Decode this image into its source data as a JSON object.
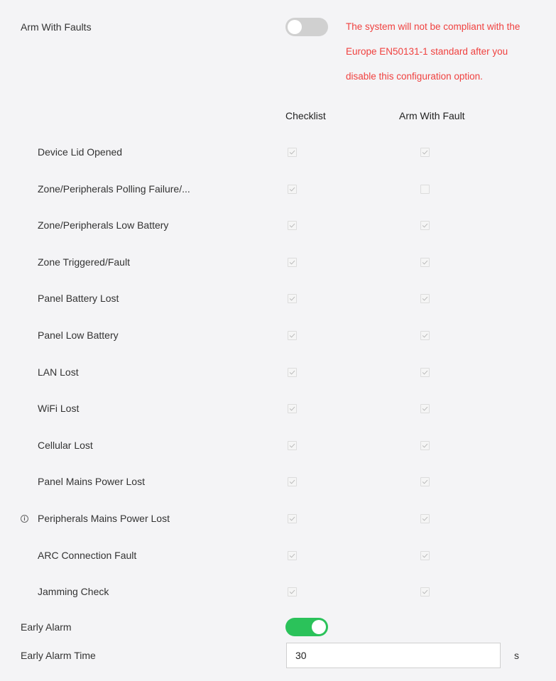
{
  "arm_with_faults": {
    "label": "Arm With Faults",
    "enabled": false,
    "warning_lines": [
      "The system will not be compliant with the",
      "Europe EN50131-1 standard after you",
      "disable this configuration option."
    ]
  },
  "columns": {
    "checklist": "Checklist",
    "arm_with_fault": "Arm With Fault"
  },
  "rows": [
    {
      "label": "Device Lid Opened",
      "checklist": true,
      "arm_with_fault": true
    },
    {
      "label": "Zone/Peripherals Polling Failure/...",
      "checklist": true,
      "arm_with_fault": false
    },
    {
      "label": "Zone/Peripherals Low Battery",
      "checklist": true,
      "arm_with_fault": true
    },
    {
      "label": "Zone Triggered/Fault",
      "checklist": true,
      "arm_with_fault": true
    },
    {
      "label": "Panel Battery Lost",
      "checklist": true,
      "arm_with_fault": true
    },
    {
      "label": "Panel Low Battery",
      "checklist": true,
      "arm_with_fault": true
    },
    {
      "label": "LAN Lost",
      "checklist": true,
      "arm_with_fault": true
    },
    {
      "label": "WiFi Lost",
      "checklist": true,
      "arm_with_fault": true
    },
    {
      "label": "Cellular Lost",
      "checklist": true,
      "arm_with_fault": true
    },
    {
      "label": "Panel Mains Power Lost",
      "checklist": true,
      "arm_with_fault": true
    },
    {
      "label": "Peripherals Mains Power Lost",
      "checklist": true,
      "arm_with_fault": true,
      "info_icon": "info-circle-icon"
    },
    {
      "label": "ARC Connection Fault",
      "checklist": true,
      "arm_with_fault": true
    },
    {
      "label": "Jamming Check",
      "checklist": true,
      "arm_with_fault": true
    }
  ],
  "early_alarm": {
    "label": "Early Alarm",
    "enabled": true
  },
  "early_alarm_time": {
    "label": "Early Alarm Time",
    "value": "30",
    "unit": "s"
  },
  "colors": {
    "toggle_on": "#2bc25a",
    "toggle_off": "#d0d0d0",
    "warning": "#f0413f",
    "checkmark": "#b9b9b9"
  }
}
